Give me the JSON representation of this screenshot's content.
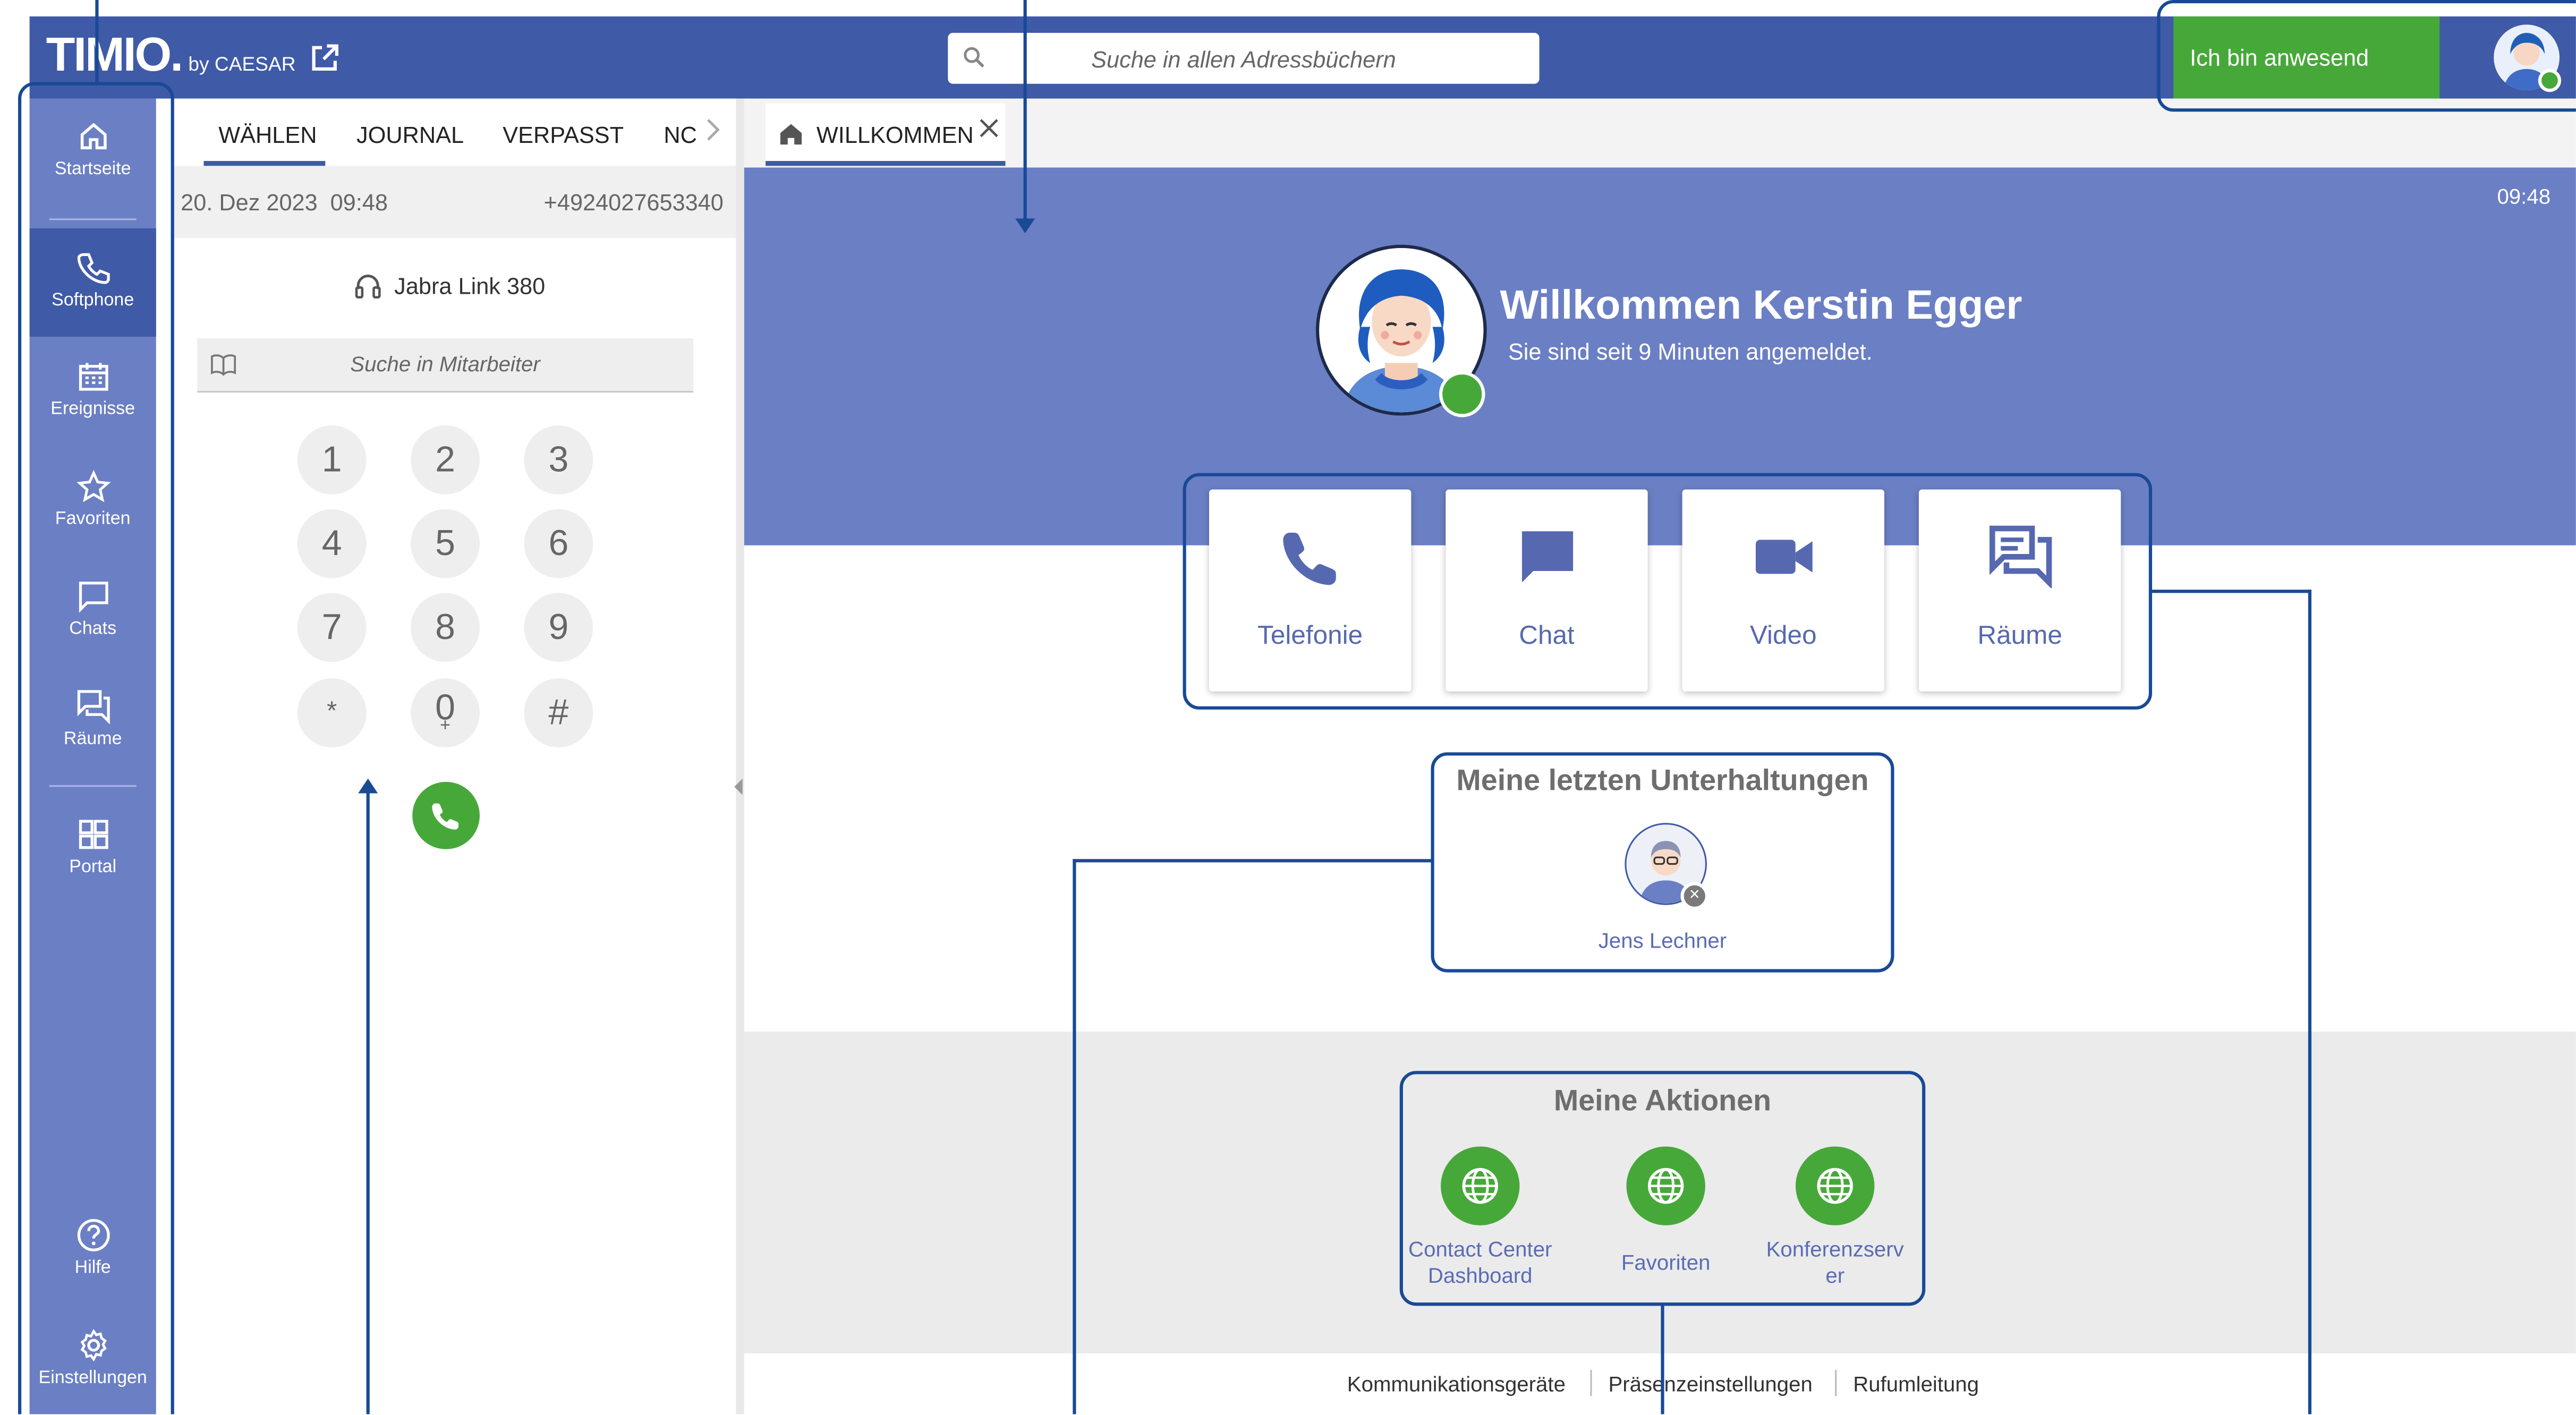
{
  "app": {
    "logo_text": "TIMIO.",
    "logo_byline": "by CAESAR"
  },
  "header": {
    "search_placeholder": "Suche in allen Adressbüchern",
    "presence_label": "Ich bin anwesend"
  },
  "sidebar": {
    "items": [
      {
        "label": "Startseite",
        "icon": "home-icon"
      },
      {
        "label": "Softphone",
        "icon": "phone-icon"
      },
      {
        "label": "Ereignisse",
        "icon": "calendar-icon"
      },
      {
        "label": "Favoriten",
        "icon": "star-icon"
      },
      {
        "label": "Chats",
        "icon": "chat-icon"
      },
      {
        "label": "Räume",
        "icon": "rooms-icon"
      },
      {
        "label": "Portal",
        "icon": "grid-icon"
      },
      {
        "label": "Hilfe",
        "icon": "help-icon"
      },
      {
        "label": "Einstellungen",
        "icon": "gear-icon"
      }
    ],
    "active": "Softphone"
  },
  "softphone": {
    "tabs": [
      "WÄHLEN",
      "JOURNAL",
      "VERPASST",
      "NC"
    ],
    "active_tab": "WÄHLEN",
    "last_call": {
      "date": "20. Dez 2023",
      "time": "09:48",
      "number": "+4924027653340"
    },
    "device": "Jabra Link 380",
    "search_placeholder": "Suche in Mitarbeiter",
    "keypad": [
      {
        "key": "1",
        "sub": ""
      },
      {
        "key": "2",
        "sub": ""
      },
      {
        "key": "3",
        "sub": ""
      },
      {
        "key": "4",
        "sub": ""
      },
      {
        "key": "5",
        "sub": ""
      },
      {
        "key": "6",
        "sub": ""
      },
      {
        "key": "7",
        "sub": ""
      },
      {
        "key": "8",
        "sub": ""
      },
      {
        "key": "9",
        "sub": ""
      },
      {
        "key": "*",
        "sub": ""
      },
      {
        "key": "0",
        "sub": "+"
      },
      {
        "key": "#",
        "sub": ""
      }
    ]
  },
  "main": {
    "tab_label": "WILLKOMMEN",
    "clock": "09:48",
    "welcome_title": "Willkommen Kerstin Egger",
    "welcome_subtitle": "Sie sind seit 9 Minuten angemeldet.",
    "quick_actions": [
      {
        "label": "Telefonie",
        "icon": "phone-icon"
      },
      {
        "label": "Chat",
        "icon": "chat-bubble-icon"
      },
      {
        "label": "Video",
        "icon": "video-camera-icon"
      },
      {
        "label": "Räume",
        "icon": "rooms-icon"
      }
    ],
    "recent": {
      "title": "Meine letzten Unterhaltungen",
      "contacts": [
        {
          "name": "Jens Lechner",
          "status": "offline"
        }
      ]
    },
    "actions": {
      "title": "Meine Aktionen",
      "items": [
        {
          "label_line1": "Contact Center",
          "label_line2": "Dashboard"
        },
        {
          "label_line1": "Favoriten",
          "label_line2": ""
        },
        {
          "label_line1": "Konferenzserv",
          "label_line2": "er"
        }
      ]
    },
    "footer_links": [
      "Kommunikationsgeräte",
      "Präsenzeinstellungen",
      "Rufumleitung"
    ]
  },
  "colors": {
    "header_bg": "#3f5aa6",
    "sidebar_bg": "#6b7fc4",
    "hero_bg": "#6b7fc4",
    "presence_green": "#47a83a",
    "callout_blue": "#184a96",
    "accent_text": "#5a6cb5"
  }
}
